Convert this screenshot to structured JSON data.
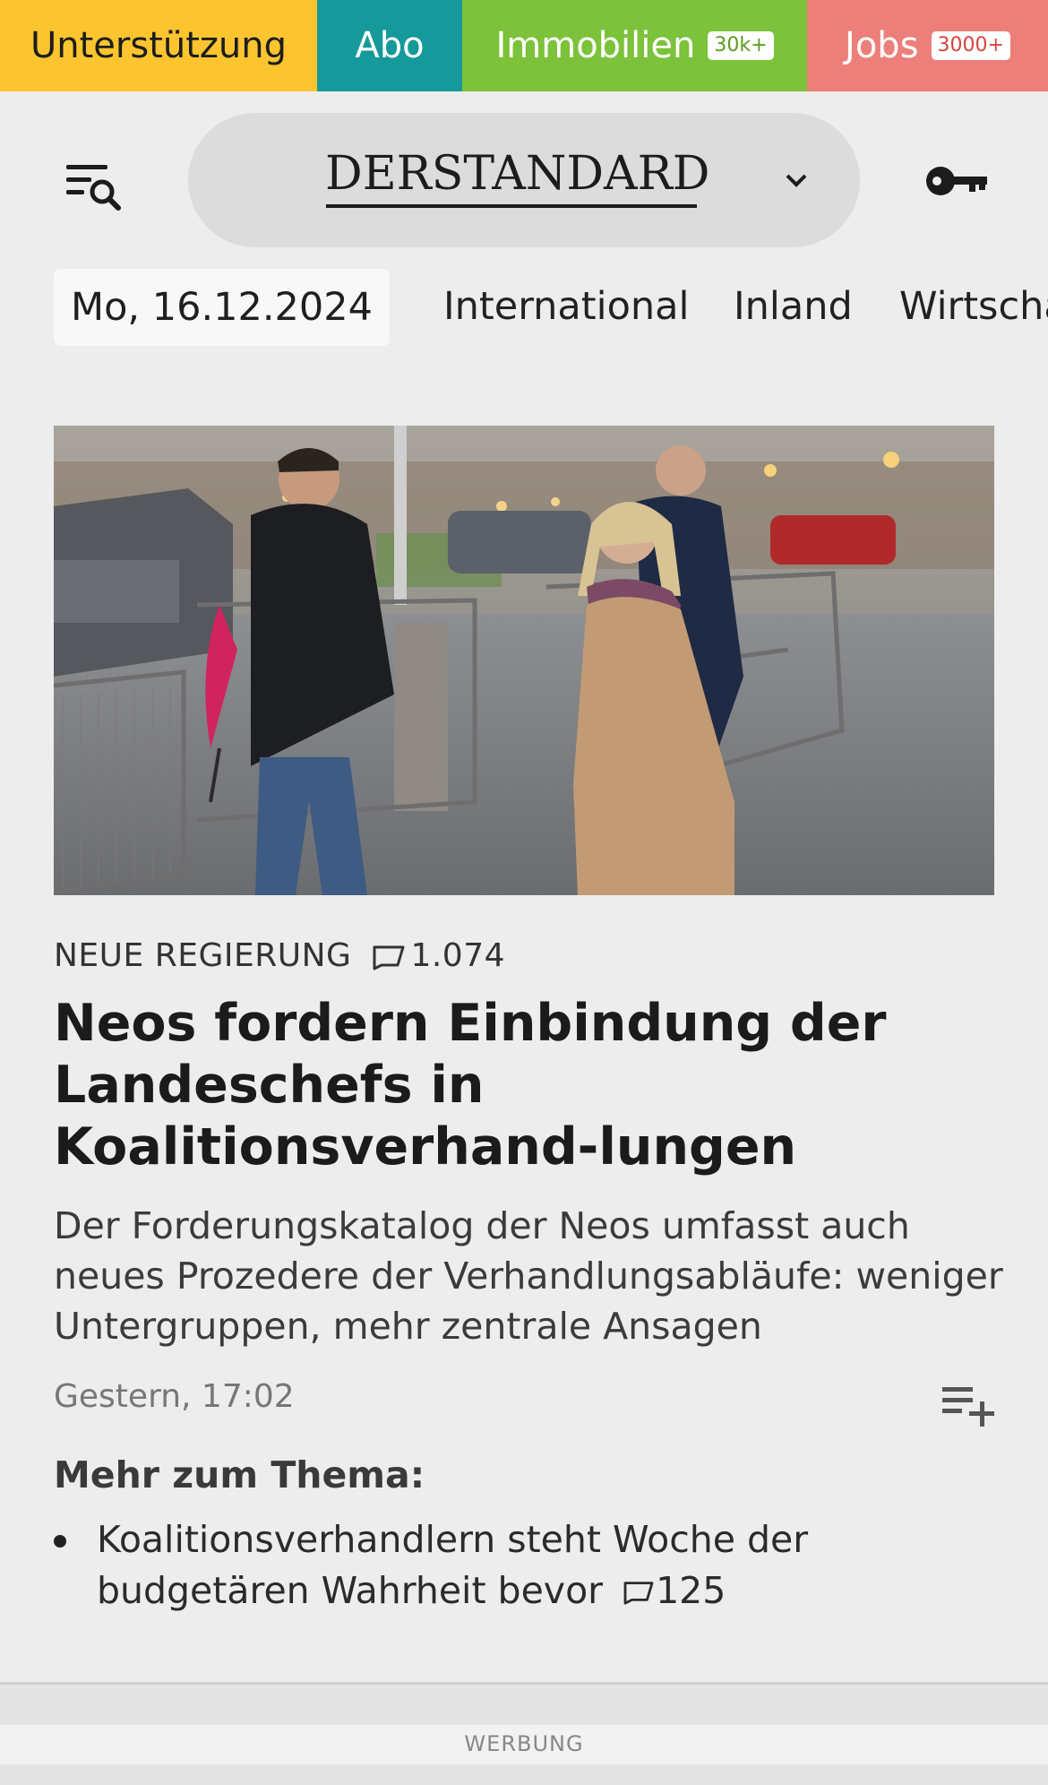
{
  "topbar": {
    "support": "Unterstützung",
    "abo": "Abo",
    "immobilien": "Immobilien",
    "immobilien_badge": "30k+",
    "jobs": "Jobs",
    "jobs_badge": "3000+"
  },
  "header": {
    "logo_text": "DERSTANDARD",
    "menu_icon": "menu-search-icon",
    "account_icon": "key-icon"
  },
  "nav": {
    "date": "Mo, 16.12.2024",
    "items": [
      "International",
      "Inland",
      "Wirtscha"
    ]
  },
  "article": {
    "image_alt": "Neos-Politiker gehen im Regen an Absperrgittern vorbei",
    "kicker": "NEUE REGIERUNG",
    "comment_count": "1.074",
    "headline": "Neos fordern Einbindung der Landeschefs in Koalitionsverhand-lungen",
    "lead": "Der Forderungskatalog der Neos umfasst auch neues Prozedere der Verhandlungsabläufe: weniger Untergruppen, mehr zentrale Ansagen",
    "timestamp": "Gestern, 17:02",
    "more_title": "Mehr zum Thema:",
    "more_items": [
      {
        "text": "Koalitionsverhandlern steht Woche der budgetären Wahrheit bevor",
        "comment_count": "125"
      }
    ]
  },
  "ad": {
    "label": "WERBUNG"
  },
  "colors": {
    "support": "#fcc52f",
    "abo": "#15999a",
    "immobilien": "#7cc23a",
    "jobs": "#ec7f79",
    "background": "#ededed"
  }
}
